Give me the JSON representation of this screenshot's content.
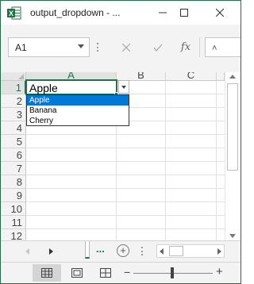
{
  "window": {
    "title": "output_dropdown - ...",
    "app_icon": "excel-icon",
    "controls": [
      "minimize-icon",
      "maximize-icon",
      "close-icon"
    ]
  },
  "formula_bar": {
    "name_box": "A1",
    "fx_label": "fx",
    "formula_value": "",
    "cancel_icon": "cancel-icon",
    "enter_icon": "checkmark-icon"
  },
  "grid": {
    "columns": [
      "A",
      "B",
      "C"
    ],
    "rows": [
      "1",
      "2",
      "3",
      "4",
      "5",
      "6",
      "7",
      "8",
      "9",
      "10",
      "11",
      "12"
    ],
    "active_cell": {
      "ref": "A1",
      "value": "Apple"
    }
  },
  "dropdown": {
    "options": [
      "Apple",
      "Banana",
      "Cherry"
    ],
    "selected": "Apple"
  },
  "sheet_tabs": {
    "ellipsis": "...",
    "add_label": "+"
  },
  "status_bar": {
    "views": [
      "normal-view-icon",
      "page-layout-icon",
      "page-break-icon"
    ],
    "zoom_minus": "−",
    "zoom_plus": "+"
  },
  "colors": {
    "accent": "#217346",
    "selection_blue": "#0078d7"
  }
}
